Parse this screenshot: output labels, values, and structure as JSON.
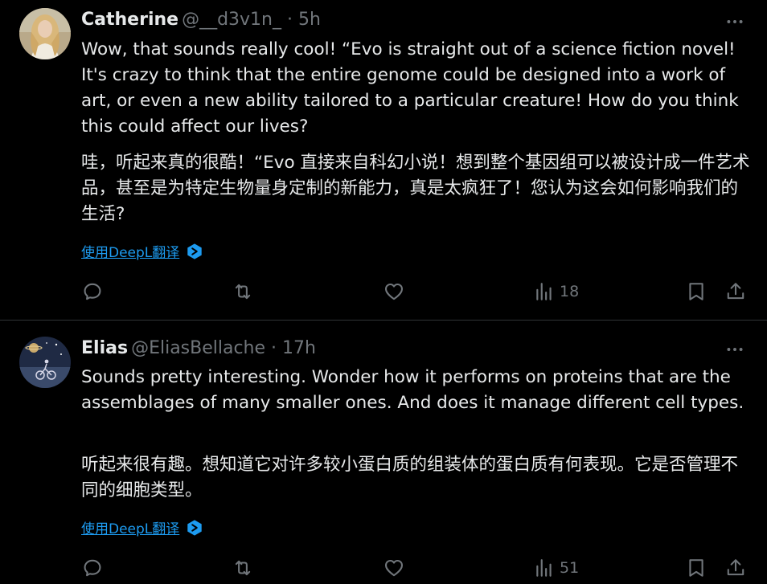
{
  "colors": {
    "background": "#000000",
    "text": "#e7e9ea",
    "secondary": "#71767b",
    "link": "#1d9bf0",
    "divider": "#2f3336"
  },
  "tweets": [
    {
      "name": "Catherine",
      "handle": "@__d3v1n_",
      "separator": "·",
      "time": "5h",
      "text_en": "Wow, that sounds really cool! “Evo is straight out of a science fiction novel! It's crazy to think that the entire genome could be designed into a work of art, or even a new ability tailored to a particular creature! How do you think this could affect our lives?",
      "text_zh": "哇，听起来真的很酷！“Evo 直接来自科幻小说！想到整个基因组可以被设计成一件艺术品，甚至是为特定生物量身定制的新能力，真是太疯狂了！您认为这会如何影响我们的生活?",
      "translate_label": "使用DeepL翻译",
      "views": "18",
      "icons": {
        "more": "more-icon",
        "reply": "reply-icon",
        "retweet": "retweet-icon",
        "like": "heart-icon",
        "views": "analytics-icon",
        "bookmark": "bookmark-icon",
        "share": "share-icon"
      }
    },
    {
      "name": "Elias",
      "handle": "@EliasBellache",
      "separator": "·",
      "time": "17h",
      "text_en": "Sounds pretty interesting. Wonder how it performs on proteins that are the assemblages of many smaller ones. And does it manage different cell types.",
      "text_zh": "听起来很有趣。想知道它对许多较小蛋白质的组装体的蛋白质有何表现。它是否管理不同的细胞类型。",
      "translate_label": "使用DeepL翻译",
      "views": "51",
      "icons": {
        "more": "more-icon",
        "reply": "reply-icon",
        "retweet": "retweet-icon",
        "like": "heart-icon",
        "views": "analytics-icon",
        "bookmark": "bookmark-icon",
        "share": "share-icon"
      }
    }
  ]
}
